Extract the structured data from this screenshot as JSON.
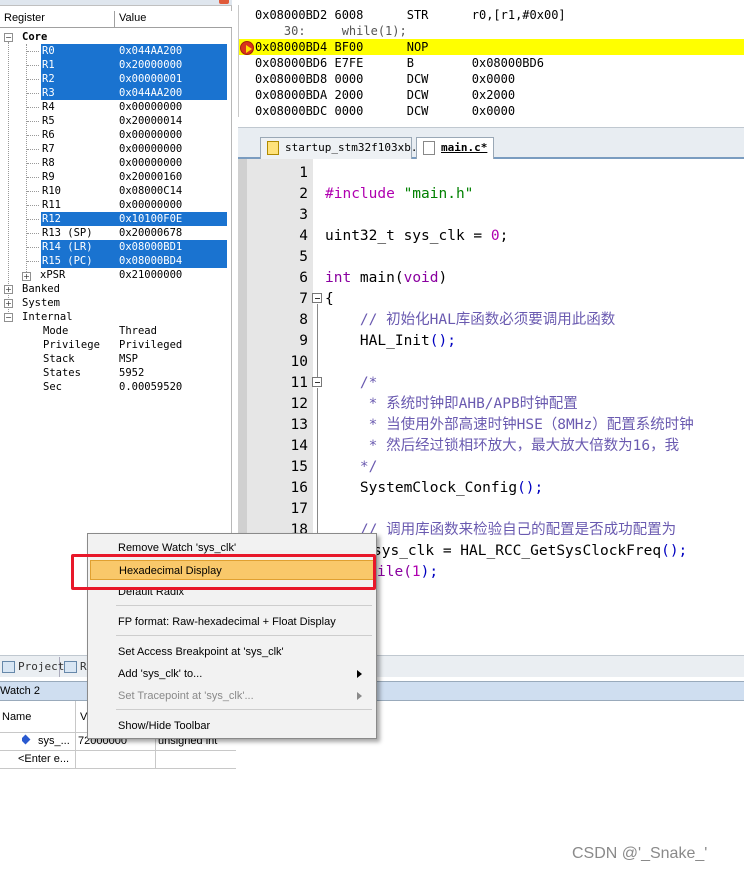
{
  "registers": {
    "header": {
      "col1": "Register",
      "col2": "Value"
    },
    "groups": {
      "core": "Core",
      "banked": "Banked",
      "system": "System",
      "internal": "Internal"
    },
    "core_rows": [
      {
        "name": "R0",
        "value": "0x044AA200",
        "selected": true
      },
      {
        "name": "R1",
        "value": "0x20000000",
        "selected": true
      },
      {
        "name": "R2",
        "value": "0x00000001",
        "selected": true
      },
      {
        "name": "R3",
        "value": "0x044AA200",
        "selected": true
      },
      {
        "name": "R4",
        "value": "0x00000000",
        "selected": false
      },
      {
        "name": "R5",
        "value": "0x20000014",
        "selected": false
      },
      {
        "name": "R6",
        "value": "0x00000000",
        "selected": false
      },
      {
        "name": "R7",
        "value": "0x00000000",
        "selected": false
      },
      {
        "name": "R8",
        "value": "0x00000000",
        "selected": false
      },
      {
        "name": "R9",
        "value": "0x20000160",
        "selected": false
      },
      {
        "name": "R10",
        "value": "0x08000C14",
        "selected": false
      },
      {
        "name": "R11",
        "value": "0x00000000",
        "selected": false
      },
      {
        "name": "R12",
        "value": "0x10100F0E",
        "selected": true
      },
      {
        "name": "R13 (SP)",
        "value": "0x20000678",
        "selected": false
      },
      {
        "name": "R14 (LR)",
        "value": "0x08000BD1",
        "selected": true
      },
      {
        "name": "R15 (PC)",
        "value": "0x08000BD4",
        "selected": true
      },
      {
        "name": "xPSR",
        "value": "0x21000000",
        "selected": false
      }
    ],
    "internal_rows": [
      {
        "name": "Mode",
        "value": "Thread"
      },
      {
        "name": "Privilege",
        "value": "Privileged"
      },
      {
        "name": "Stack",
        "value": "MSP"
      },
      {
        "name": "States",
        "value": "5952"
      },
      {
        "name": "Sec",
        "value": "0.00059520"
      }
    ]
  },
  "disassembly": {
    "lines": [
      {
        "text": "0x08000BD2 6008      STR      r0,[r1,#0x00]",
        "highlight": false,
        "kind": "asm"
      },
      {
        "text": "    30:     while(1);",
        "highlight": false,
        "kind": "src"
      },
      {
        "text": "0x08000BD4 BF00      NOP",
        "highlight": true,
        "kind": "asm"
      },
      {
        "text": "0x08000BD6 E7FE      B        0x08000BD6",
        "highlight": false,
        "kind": "asm"
      },
      {
        "text": "0x08000BD8 0000      DCW      0x0000",
        "highlight": false,
        "kind": "asm"
      },
      {
        "text": "0x08000BDA 2000      DCW      0x2000",
        "highlight": false,
        "kind": "asm"
      },
      {
        "text": "0x08000BDC 0000      DCW      0x0000",
        "highlight": false,
        "kind": "asm"
      }
    ]
  },
  "tabs": [
    {
      "label": "startup_stm32f103xb.s",
      "active": false
    },
    {
      "label": "main.c*",
      "active": true
    }
  ],
  "editor": {
    "line_numbers": [
      "1",
      "2",
      "3",
      "4",
      "5",
      "6",
      "7",
      "8",
      "9",
      "10",
      "11",
      "12",
      "13",
      "14",
      "15",
      "16",
      "17",
      "18",
      "19"
    ],
    "code": {
      "l2_a": "#include ",
      "l2_b": "\"main.h\"",
      "l4_a": "uint32_t sys_clk = ",
      "l4_b": "0",
      "l4_c": ";",
      "l6_a": "int",
      "l6_b": " main(",
      "l6_c": "void",
      "l6_d": ")",
      "l7": "{",
      "l8": "    // 初始化HAL库函数必须要调用此函数",
      "l9_a": "    HAL_Init",
      "l9_b": "();",
      "l11": "    /*",
      "l12": "     * 系统时钟即AHB/APB时钟配置",
      "l13": "     * 当使用外部高速时钟HSE（8MHz）配置系统时钟",
      "l14": "     * 然后经过锁相环放大，最大放大倍数为16，我",
      "l15": "    */",
      "l16_a": "    SystemClock_Config",
      "l16_b": "();",
      "l18": "    // 调用库函数来检验自己的配置是否成功配置为",
      "l19_a": "sys_clk = HAL_RCC_GetSysClockFreq",
      "l19_b": "();",
      "l20_a": "ile(",
      "l20_b": "1",
      "l20_c": ");"
    }
  },
  "bottom_tabs": [
    {
      "label": "Project"
    },
    {
      "label": "R"
    }
  ],
  "watch": {
    "title": "Watch 2",
    "columns": [
      "Name",
      "V"
    ],
    "rows": [
      {
        "name": "sys_...",
        "value": "72000000",
        "type": "unsigned int"
      },
      {
        "name": "<Enter e...",
        "value": "",
        "type": ""
      }
    ]
  },
  "context_menu": {
    "items": [
      {
        "label": "Remove Watch 'sys_clk'",
        "disabled": false,
        "selected": false,
        "submenu": false
      },
      {
        "label": "Hexadecimal Display",
        "disabled": false,
        "selected": true,
        "submenu": false
      },
      {
        "label": "Default Radix",
        "disabled": false,
        "selected": false,
        "submenu": false
      },
      {
        "label": "FP format: Raw-hexadecimal + Float Display",
        "disabled": false,
        "selected": false,
        "submenu": false
      },
      {
        "label": "Set Access Breakpoint at 'sys_clk'",
        "disabled": false,
        "selected": false,
        "submenu": false
      },
      {
        "label": "Add 'sys_clk' to...",
        "disabled": false,
        "selected": false,
        "submenu": true
      },
      {
        "label": "Set Tracepoint at 'sys_clk'...",
        "disabled": true,
        "selected": false,
        "submenu": true
      },
      {
        "label": "Show/Hide Toolbar",
        "disabled": false,
        "selected": false,
        "submenu": false
      }
    ]
  },
  "watermark": "CSDN @'_Snake_'",
  "colors": {
    "selection": "#1a73d0",
    "current_line": "#ffff00",
    "menu_highlight": "#f9c86a",
    "annotation": "#e8182a"
  }
}
